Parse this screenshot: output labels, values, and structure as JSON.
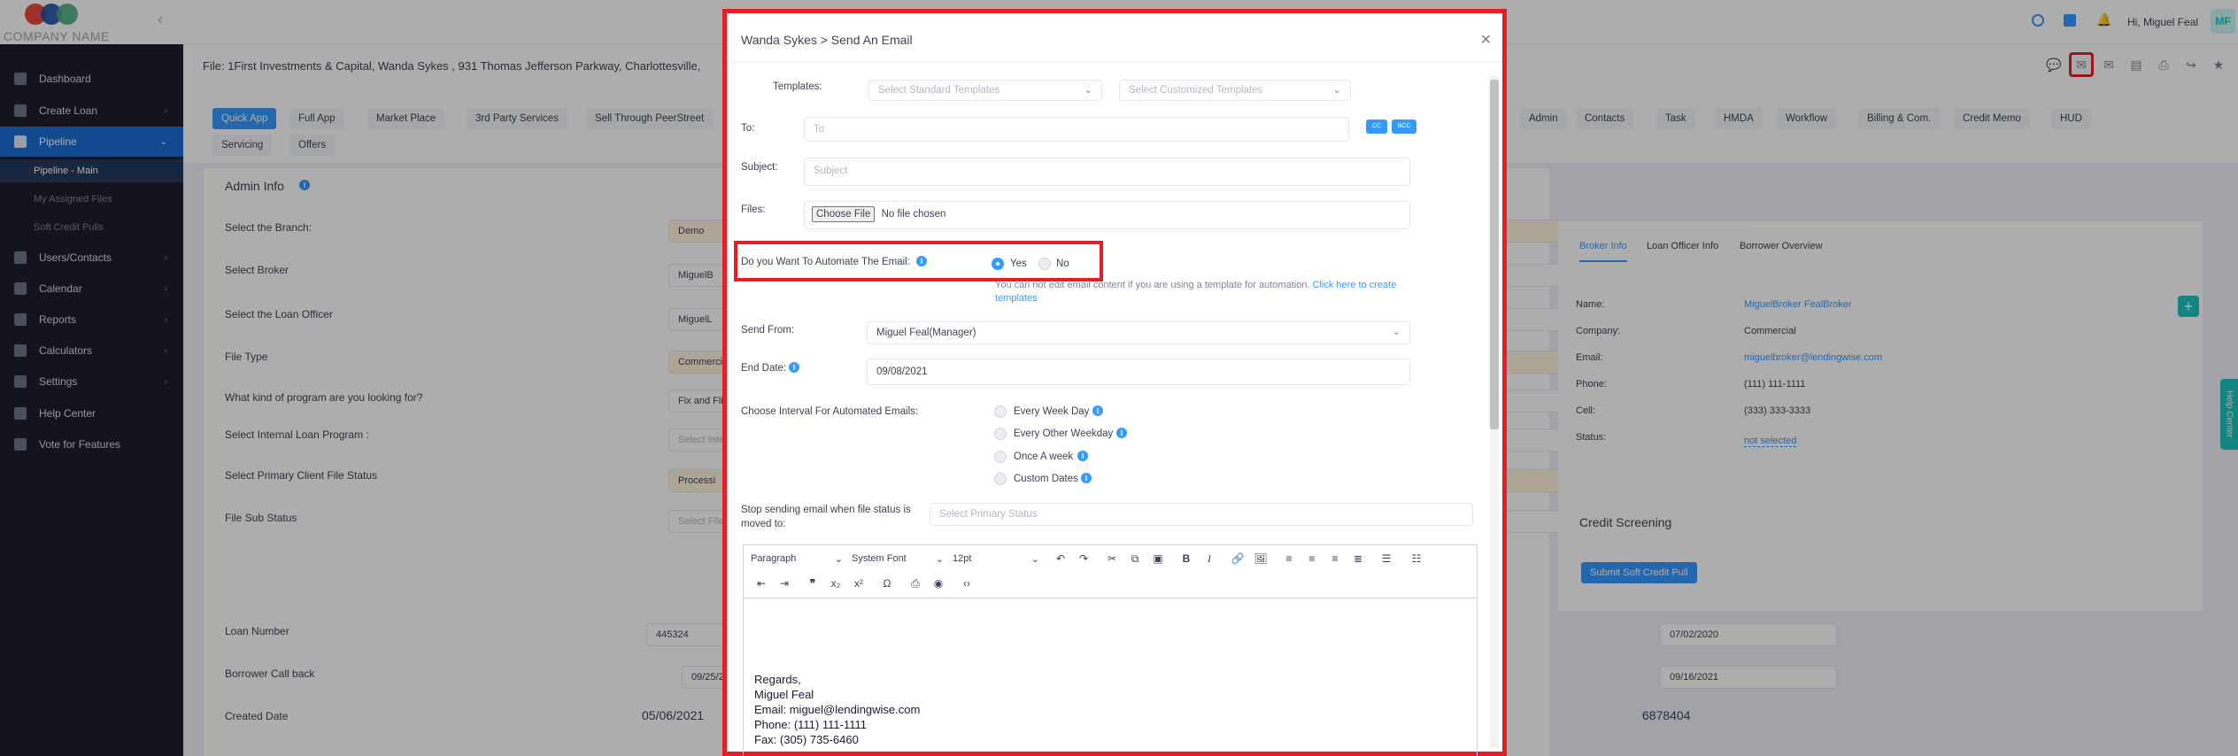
{
  "brand": {
    "company": "COMPANY NAME",
    "colors": {
      "red": "#e84a3c",
      "blue": "#1f4fa3",
      "green": "#4bab7c"
    }
  },
  "sidebar": {
    "items": [
      {
        "label": "Dashboard",
        "icon": "home-icon"
      },
      {
        "label": "Create Loan",
        "icon": "file-icon"
      },
      {
        "label": "Pipeline",
        "icon": "grid-icon"
      },
      {
        "label": "Users/Contacts",
        "icon": "users-icon"
      },
      {
        "label": "Calendar",
        "icon": "calendar-icon"
      },
      {
        "label": "Reports",
        "icon": "reports-icon"
      },
      {
        "label": "Calculators",
        "icon": "calculator-icon"
      },
      {
        "label": "Settings",
        "icon": "wrench-icon"
      },
      {
        "label": "Help Center",
        "icon": "help-icon"
      },
      {
        "label": "Vote for Features",
        "icon": "vote-icon"
      }
    ],
    "pipeline_sub": [
      "Pipeline - Main",
      "My Assigned Files",
      "Soft Credit Pulls"
    ]
  },
  "header": {
    "greeting": "Hi, Miguel Feal",
    "avatar_initials": "MF"
  },
  "file_title": "File: 1First Investments & Capital, Wanda Sykes , 931 Thomas Jefferson Parkway, Charlottesville,",
  "tabs": {
    "row1": [
      "Quick App",
      "Full App",
      "Market Place",
      "3rd Party Services",
      "Sell Through PeerStreet",
      "Admin",
      "Contacts",
      "Task",
      "HMDA",
      "Workflow",
      "Billing & Com.",
      "Credit Memo",
      "HUD"
    ],
    "row2": [
      "Servicing",
      "Offers"
    ]
  },
  "admin": {
    "title": "Admin Info",
    "labels": [
      "Select the Branch:",
      "Select Broker",
      "Select the Loan Officer",
      "File Type",
      "What kind of program are you looking for?",
      "Select Internal Loan Program :",
      "Select Primary Client File Status",
      "File Sub Status"
    ],
    "values": [
      "Demo",
      "MiguelB",
      "MiguelL",
      "Commercia",
      "Fix and Fli",
      "Select Inte",
      "Processi",
      "Select File"
    ],
    "loan_number_label": "Loan Number",
    "loan_number": "445324",
    "borrower_call_label": "Borrower Call back",
    "borrower_call": "09/25/2",
    "created_label": "Created Date",
    "created": "05/06/2021",
    "right_date1": "07/02/2020",
    "right_date2": "09/16/2021",
    "right_num": "6878404"
  },
  "broker_panel": {
    "tabs": [
      "Broker Info",
      "Loan Officer Info",
      "Borrower Overview"
    ],
    "fields": [
      {
        "label": "Name:",
        "value": "MiguelBroker FealBroker"
      },
      {
        "label": "Company:",
        "value": "Commercial"
      },
      {
        "label": "Email:",
        "value": "miguelbroker@lendingwise.com"
      },
      {
        "label": "Phone:",
        "value": "(111) 111-1111"
      },
      {
        "label": "Cell:",
        "value": "(333) 333-3333"
      },
      {
        "label": "Status:",
        "value": "not selected"
      }
    ]
  },
  "credit": {
    "title": "Credit Screening",
    "button": "Submit Soft Credit Pull"
  },
  "help_tab": "Help Center",
  "modal": {
    "title": "Wanda Sykes > Send An Email",
    "templates_label": "Templates:",
    "standard_placeholder": "Select Standard Templates",
    "custom_placeholder": "Select Customized Templates",
    "to_label": "To:",
    "to_placeholder": "To",
    "cc": "CC",
    "bcc": "BCC",
    "subject_label": "Subject:",
    "subject_placeholder": "Subject",
    "files_label": "Files:",
    "choose_file": "Choose File",
    "no_file": "No file chosen",
    "automate_label": "Do you Want To Automate The Email:",
    "yes": "Yes",
    "no": "No",
    "automate_note": "You can not edit email content if you are using a template for automation.",
    "automate_link": "Click here to create templates",
    "send_from_label": "Send From:",
    "send_from": "Miguel Feal(Manager)",
    "end_date_label": "End Date:",
    "end_date": "09/08/2021",
    "interval_label": "Choose Interval For Automated Emails:",
    "intervals": [
      "Every Week Day",
      "Every Other Weekday",
      "Once A week",
      "Custom Dates"
    ],
    "stop_label": "Stop sending email when file status is moved to:",
    "stop_placeholder": "Select Primary Status",
    "editor": {
      "paragraph": "Paragraph",
      "font": "System Font",
      "size": "12pt",
      "lines": [
        "Regards,",
        "Miguel Feal",
        "Email: miguel@lendingwise.com",
        "Phone: (111) 111-1111",
        "Fax: (305) 735-6460"
      ]
    }
  }
}
